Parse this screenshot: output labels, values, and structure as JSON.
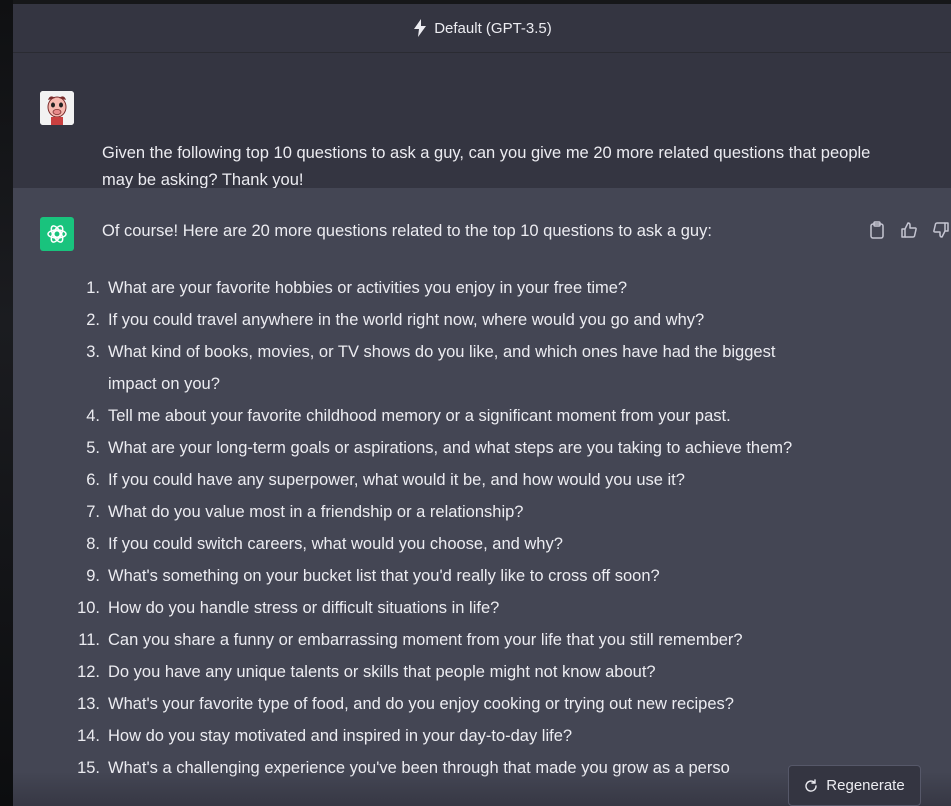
{
  "model_bar": {
    "label": "Default (GPT-3.5)"
  },
  "user_message": {
    "text": "Given the following top 10 questions to ask a guy, can you give me 20 more related questions that people may be asking? Thank you!"
  },
  "assistant_message": {
    "intro": "Of course! Here are 20 more questions related to the top 10 questions to ask a guy:",
    "questions": [
      {
        "num": "1.",
        "text": "What are your favorite hobbies or activities you enjoy in your free time?"
      },
      {
        "num": "2.",
        "text": "If you could travel anywhere in the world right now, where would you go and why?"
      },
      {
        "num": "3.",
        "text": "What kind of books, movies, or TV shows do you like, and which ones have had the biggest impact on you?"
      },
      {
        "num": "4.",
        "text": "Tell me about your favorite childhood memory or a significant moment from your past."
      },
      {
        "num": "5.",
        "text": "What are your long-term goals or aspirations, and what steps are you taking to achieve them?"
      },
      {
        "num": "6.",
        "text": "If you could have any superpower, what would it be, and how would you use it?"
      },
      {
        "num": "7.",
        "text": "What do you value most in a friendship or a relationship?"
      },
      {
        "num": "8.",
        "text": "If you could switch careers, what would you choose, and why?"
      },
      {
        "num": "9.",
        "text": "What's something on your bucket list that you'd really like to cross off soon?"
      },
      {
        "num": "10.",
        "text": "How do you handle stress or difficult situations in life?"
      },
      {
        "num": "11.",
        "text": "Can you share a funny or embarrassing moment from your life that you still remember?"
      },
      {
        "num": "12.",
        "text": "Do you have any unique talents or skills that people might not know about?"
      },
      {
        "num": "13.",
        "text": "What's your favorite type of food, and do you enjoy cooking or trying out new recipes?"
      },
      {
        "num": "14.",
        "text": "How do you stay motivated and inspired in your day-to-day life?"
      },
      {
        "num": "15.",
        "text": "What's a challenging experience you've been through that made you grow as a perso"
      }
    ]
  },
  "regenerate": {
    "label": "Regenerate"
  },
  "icons": {
    "model": "bolt-icon",
    "user_avatar": "user-avatar",
    "assistant_avatar": "openai-logo-icon",
    "copy": "clipboard-icon",
    "like": "thumbs-up-icon",
    "dislike": "thumbs-down-icon",
    "regenerate": "refresh-icon"
  },
  "colors": {
    "background": "#343541",
    "assistant_background": "#444654",
    "assistant_avatar": "#19c37d",
    "text": "#ececf1"
  }
}
